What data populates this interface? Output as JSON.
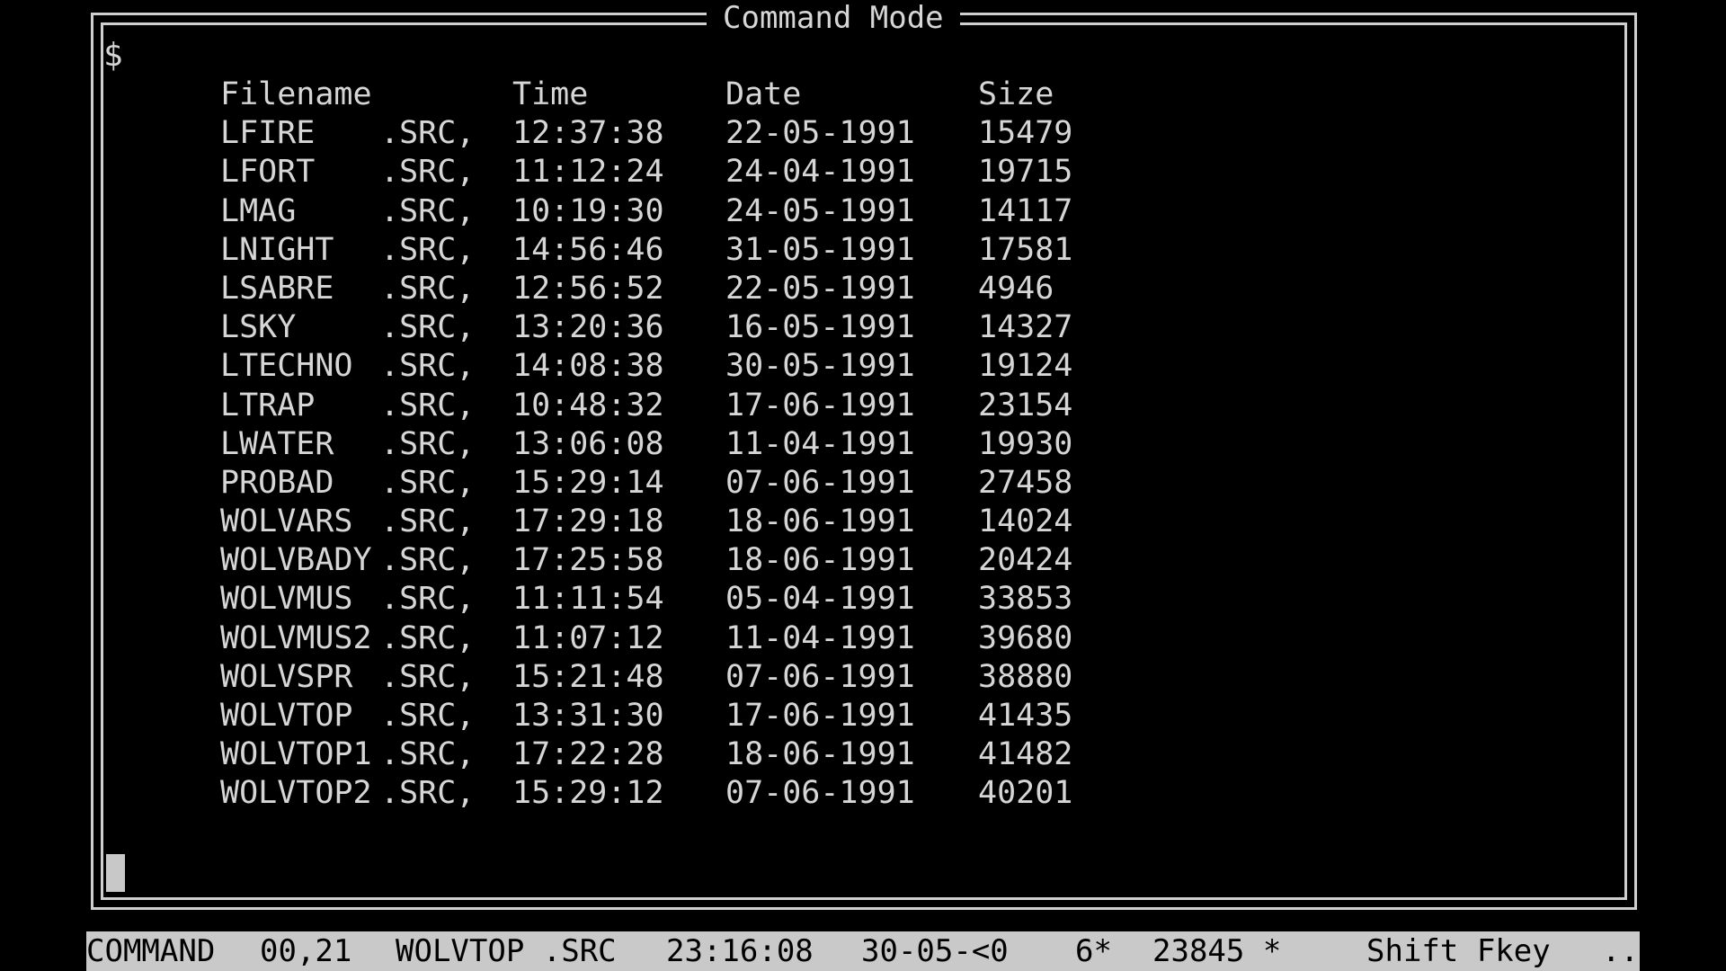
{
  "frame": {
    "title": "Command Mode",
    "border_color": "#cfcfcf",
    "background": "#000000",
    "text_color": "#d6d6d6"
  },
  "prompt": "$",
  "listing": {
    "headers": {
      "filename": "Filename",
      "time": "Time",
      "date": "Date",
      "size": "Size"
    },
    "rows": [
      {
        "name": "LFIRE",
        "ext": ".SRC,",
        "time": "12:37:38",
        "date": "22-05-1991",
        "size": "15479"
      },
      {
        "name": "LFORT",
        "ext": ".SRC,",
        "time": "11:12:24",
        "date": "24-04-1991",
        "size": "19715"
      },
      {
        "name": "LMAG",
        "ext": ".SRC,",
        "time": "10:19:30",
        "date": "24-05-1991",
        "size": "14117"
      },
      {
        "name": "LNIGHT",
        "ext": ".SRC,",
        "time": "14:56:46",
        "date": "31-05-1991",
        "size": "17581"
      },
      {
        "name": "LSABRE",
        "ext": ".SRC,",
        "time": "12:56:52",
        "date": "22-05-1991",
        "size": "4946"
      },
      {
        "name": "LSKY",
        "ext": ".SRC,",
        "time": "13:20:36",
        "date": "16-05-1991",
        "size": "14327"
      },
      {
        "name": "LTECHNO",
        "ext": ".SRC,",
        "time": "14:08:38",
        "date": "30-05-1991",
        "size": "19124"
      },
      {
        "name": "LTRAP",
        "ext": ".SRC,",
        "time": "10:48:32",
        "date": "17-06-1991",
        "size": "23154"
      },
      {
        "name": "LWATER",
        "ext": ".SRC,",
        "time": "13:06:08",
        "date": "11-04-1991",
        "size": "19930"
      },
      {
        "name": "PROBAD",
        "ext": ".SRC,",
        "time": "15:29:14",
        "date": "07-06-1991",
        "size": "27458"
      },
      {
        "name": "WOLVARS",
        "ext": ".SRC,",
        "time": "17:29:18",
        "date": "18-06-1991",
        "size": "14024"
      },
      {
        "name": "WOLVBADY",
        "ext": ".SRC,",
        "time": "17:25:58",
        "date": "18-06-1991",
        "size": "20424"
      },
      {
        "name": "WOLVMUS",
        "ext": ".SRC,",
        "time": "11:11:54",
        "date": "05-04-1991",
        "size": "33853"
      },
      {
        "name": "WOLVMUS2",
        "ext": ".SRC,",
        "time": "11:07:12",
        "date": "11-04-1991",
        "size": "39680"
      },
      {
        "name": "WOLVSPR",
        "ext": ".SRC,",
        "time": "15:21:48",
        "date": "07-06-1991",
        "size": "38880"
      },
      {
        "name": "WOLVTOP",
        "ext": ".SRC,",
        "time": "13:31:30",
        "date": "17-06-1991",
        "size": "41435"
      },
      {
        "name": "WOLVTOP1",
        "ext": ".SRC,",
        "time": "17:22:28",
        "date": "18-06-1991",
        "size": "41482"
      },
      {
        "name": "WOLVTOP2",
        "ext": ".SRC,",
        "time": "15:29:12",
        "date": "07-06-1991",
        "size": "40201"
      }
    ]
  },
  "statusbar": {
    "mode": "COMMAND",
    "position": "00,21",
    "filename": "WOLVTOP .SRC",
    "time": "23:16:08",
    "date": "30-05-<0",
    "count": "6*",
    "value": "23845 *",
    "hint": "Shift Fkey",
    "more": "..",
    "background": "#c9c9c9",
    "text_color": "#000000"
  }
}
